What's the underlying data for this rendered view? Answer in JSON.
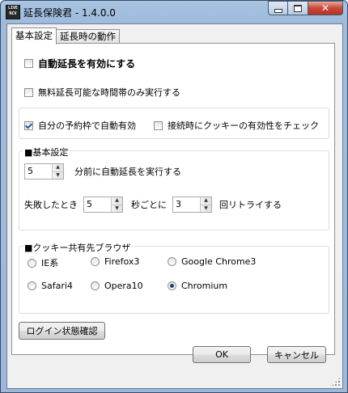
{
  "window": {
    "title": "延長保険君 - 1.4.0.0",
    "icon_text": "LIVE NCV",
    "close_glyph": "✕"
  },
  "tabs": [
    {
      "label": "基本設定",
      "active": true
    },
    {
      "label": "延長時の動作",
      "active": false
    }
  ],
  "options": {
    "auto_extend": {
      "label": "自動延長を有効にする",
      "checked": false
    },
    "free_time_only": {
      "label": "無料延長可能な時間帯のみ実行する",
      "checked": false
    },
    "own_reservation": {
      "label": "自分の予約枠で自動有効",
      "checked": true
    },
    "cookie_check": {
      "label": "接続時にクッキーの有効性をチェック",
      "checked": false
    }
  },
  "basic_group": {
    "title": "■基本設定",
    "minutes_value": "5",
    "minutes_label": "分前に自動延長を実行する",
    "fail_label": "失敗したとき",
    "fail_interval_value": "5",
    "interval_label": "秒ごとに",
    "retry_value": "3",
    "retry_label": "回リトライする"
  },
  "cookie_group": {
    "title": "■クッキー共有先ブラウザ",
    "browsers": [
      {
        "label": "IE系",
        "selected": false
      },
      {
        "label": "Firefox3",
        "selected": false
      },
      {
        "label": "Google Chrome3",
        "selected": false
      },
      {
        "label": "Safari4",
        "selected": false
      },
      {
        "label": "Opera10",
        "selected": false
      },
      {
        "label": "Chromium",
        "selected": true
      }
    ]
  },
  "login_button": "ログイン状態確認",
  "ok_button": "OK",
  "cancel_button": "キャンセル",
  "spin_up_glyph": "▲",
  "spin_down_glyph": "▼"
}
